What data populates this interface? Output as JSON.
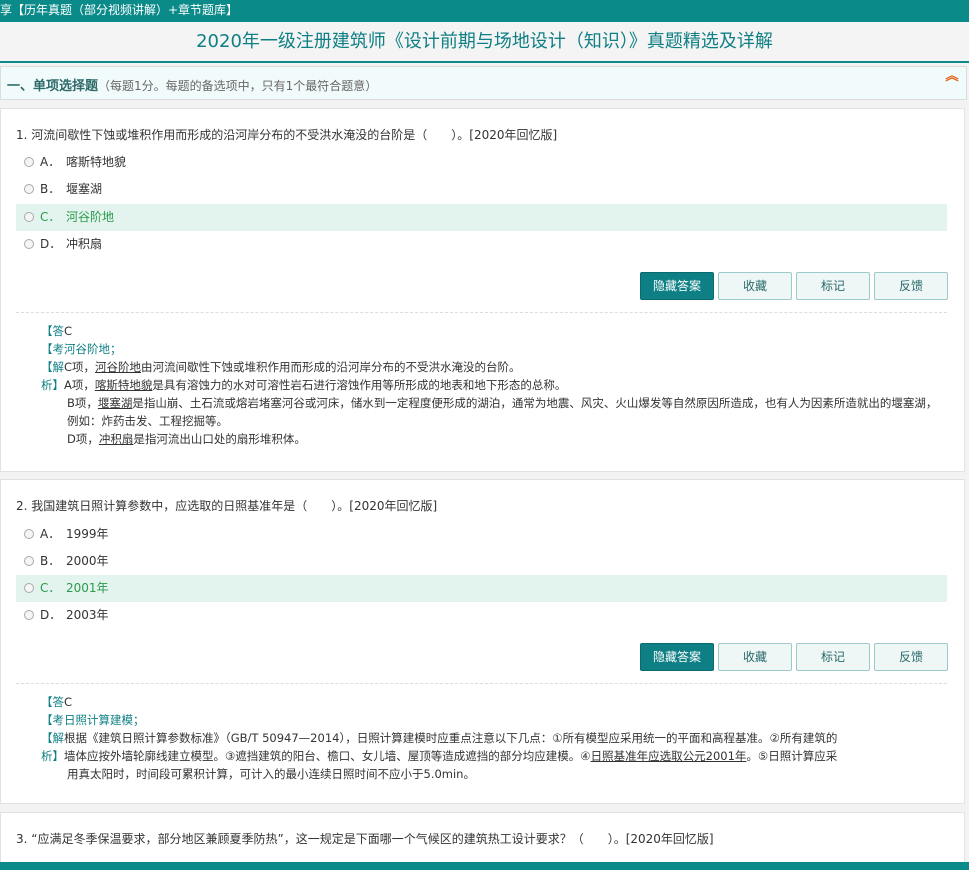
{
  "header": {
    "breadcrumb": "享【历年真题（部分视频讲解）+章节题库】",
    "title": "2020年一级注册建筑师《设计前期与场地设计（知识）》真题精选及详解"
  },
  "section": {
    "heading": "一、单项选择题",
    "note": "（每题1分。每题的备选项中，只有1个最符合题意）"
  },
  "buttons": {
    "hide": "隐藏答案",
    "fav": "收藏",
    "mark": "标记",
    "feedback": "反馈"
  },
  "q1": {
    "text": "1. 河流间歇性下蚀或堆积作用而形成的沿河岸分布的不受洪水淹没的台阶是（　　）。[2020年回忆版]",
    "options": [
      {
        "letter": "A．",
        "text": "喀斯特地貌"
      },
      {
        "letter": "B．",
        "text": "堰塞湖"
      },
      {
        "letter": "C．",
        "text": "河谷阶地"
      },
      {
        "letter": "D．",
        "text": "冲积扇"
      }
    ],
    "answer_label": "【答",
    "answer": "C",
    "point_label": "【考",
    "point": "河谷阶地；",
    "analysis_label_1": "【解",
    "analysis_label_2": "析】",
    "line1_a": "C项，",
    "line1_u": "河谷阶地",
    "line1_b": "由河流间歇性下蚀或堆积作用而形成的沿河岸分布的不受洪水淹没的台阶。",
    "line2_a": "A项，",
    "line2_u": "喀斯特地貌",
    "line2_b": "是具有溶蚀力的水对可溶性岩石进行溶蚀作用等所形成的地表和地下形态的总称。",
    "line3_a": "B项，",
    "line3_u": "堰塞湖",
    "line3_b": "是指山崩、土石流或熔岩堵塞河谷或河床，储水到一定程度便形成的湖泊，通常为地震、风灾、火山爆发等自然原因所造成，也有人为因素所造就出的堰塞湖，例如：炸药击发、工程挖掘等。",
    "line4_a": "D项，",
    "line4_u": "冲积扇",
    "line4_b": "是指河流出山口处的扇形堆积体。"
  },
  "q2": {
    "text": "2. 我国建筑日照计算参数中，应选取的日照基准年是（　　）。[2020年回忆版]",
    "options": [
      {
        "letter": "A．",
        "text": "1999年"
      },
      {
        "letter": "B．",
        "text": "2000年"
      },
      {
        "letter": "C．",
        "text": "2001年"
      },
      {
        "letter": "D．",
        "text": "2003年"
      }
    ],
    "answer_label": "【答",
    "answer": "C",
    "point_label": "【考",
    "point": "日照计算建模；",
    "analysis_label_1": "【解",
    "analysis_label_2": "析】",
    "line1": "根据《建筑日照计算参数标准》（GB/T 50947—2014），日照计算建模时应重点注意以下几点：①所有模型应采用统一的平面和高程基准。②所有建筑的",
    "line2_a": "墙体应按外墙轮廓线建立模型。③遮挡建筑的阳台、檐口、女儿墙、屋顶等造成遮挡的部分均应建模。④",
    "line2_u": "日照基准年应选取公元2001年",
    "line2_b": "。⑤日照计算应采",
    "line3": "用真太阳时，时间段可累积计算，可计入的最小连续日照时间不应小于5.0min。"
  },
  "q3": {
    "text": "3. “应满足冬季保温要求，部分地区兼顾夏季防热”，这一规定是下面哪一个气候区的建筑热工设计要求？（　　）。[2020年回忆版]"
  },
  "colors": {
    "teal": "#0e7f84",
    "correct_bg": "#e3f4ee",
    "correct_text": "#2a9a4c"
  }
}
